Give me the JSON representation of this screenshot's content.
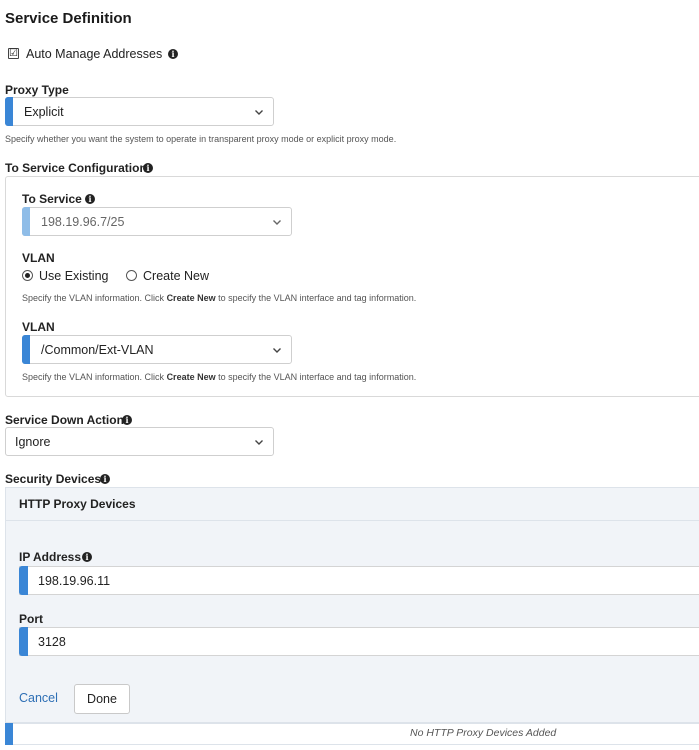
{
  "section_title": "Service Definition",
  "auto_manage": {
    "label": "Auto Manage Addresses",
    "checked": true,
    "check_glyph": "☑"
  },
  "info_glyph": "i",
  "proxy_type": {
    "label": "Proxy Type",
    "value": "Explicit",
    "help": "Specify whether you want the system to operate in transparent proxy mode or explicit proxy mode."
  },
  "to_service_config": {
    "label": "To Service Configuration",
    "to_service": {
      "label": "To Service",
      "value": "198.19.96.7/25"
    },
    "vlan_mode": {
      "label": "VLAN",
      "options": [
        {
          "label": "Use Existing",
          "selected": true
        },
        {
          "label": "Create New",
          "selected": false
        }
      ],
      "help_prefix": "Specify the VLAN information. Click ",
      "help_bold": "Create New",
      "help_suffix": " to specify the VLAN interface and tag information."
    },
    "vlan": {
      "label": "VLAN",
      "value": "/Common/Ext-VLAN",
      "help_prefix": "Specify the VLAN information. Click ",
      "help_bold": "Create New",
      "help_suffix": " to specify the VLAN interface and tag information."
    }
  },
  "service_down_action": {
    "label": "Service Down Action",
    "value": "Ignore"
  },
  "security_devices": {
    "label": "Security Devices",
    "panel_title": "HTTP Proxy Devices",
    "ip_address": {
      "label": "IP Address",
      "value": "198.19.96.11"
    },
    "port": {
      "label": "Port",
      "value": "3128"
    },
    "cancel_label": "Cancel",
    "done_label": "Done",
    "empty_text": "No HTTP Proxy Devices Added"
  },
  "colors": {
    "accent": "#3a86d6",
    "accent_light": "#8fbde8",
    "link": "#2e6fb5",
    "panel_bg": "#f1f4f8"
  }
}
